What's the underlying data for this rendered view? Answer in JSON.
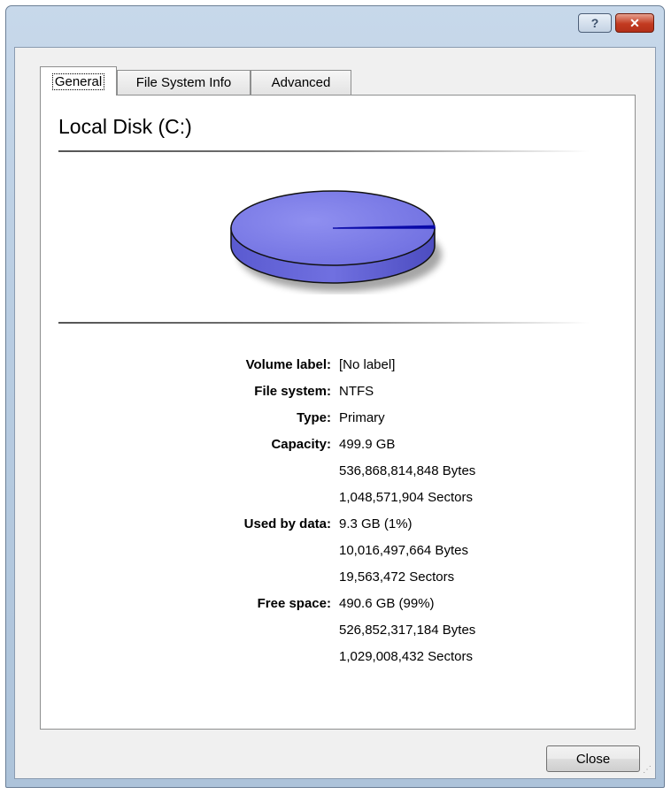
{
  "titlebar": {
    "help_icon": "question-mark-icon",
    "help_glyph": "?",
    "close_icon": "close-x-icon",
    "close_glyph": "✕"
  },
  "tabs": [
    {
      "label": "General",
      "active": true
    },
    {
      "label": "File System Info",
      "active": false
    },
    {
      "label": "Advanced",
      "active": false
    }
  ],
  "disk": {
    "title": "Local Disk (C:)",
    "usage_chart": {
      "used_fraction": 0.01,
      "free_fraction": 0.99,
      "free_color": "#7f7fe8",
      "used_color": "#0a0aa8"
    }
  },
  "properties": [
    {
      "label": "Volume label:",
      "values": [
        "[No label]"
      ]
    },
    {
      "label": "File system:",
      "values": [
        "NTFS"
      ]
    },
    {
      "label": "Type:",
      "values": [
        "Primary"
      ]
    },
    {
      "label": "Capacity:",
      "values": [
        "499.9 GB",
        "536,868,814,848 Bytes",
        "1,048,571,904 Sectors"
      ]
    },
    {
      "label": "Used by data:",
      "values": [
        "9.3 GB (1%)",
        "10,016,497,664 Bytes",
        "19,563,472 Sectors"
      ]
    },
    {
      "label": "Free space:",
      "values": [
        "490.6 GB (99%)",
        "526,852,317,184 Bytes",
        "1,029,008,432 Sectors"
      ]
    }
  ],
  "footer": {
    "close_label": "Close"
  }
}
